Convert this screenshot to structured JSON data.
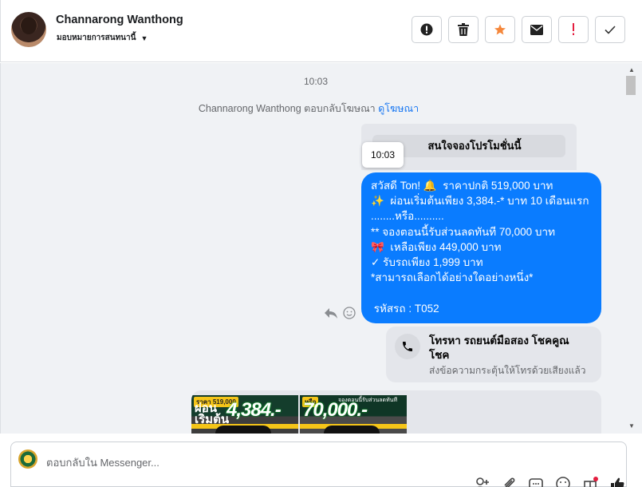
{
  "header": {
    "name": "Channarong Wanthong",
    "assign_label": "มอบหมายการสนทนานี้",
    "actions": [
      {
        "name": "report-button",
        "icon": "alert-circle-icon"
      },
      {
        "name": "delete-button",
        "icon": "trash-icon"
      },
      {
        "name": "star-button",
        "icon": "star-icon",
        "color": "#f5873b"
      },
      {
        "name": "mark-unread-button",
        "icon": "envelope-icon"
      },
      {
        "name": "spam-button",
        "icon": "exclamation-icon",
        "color": "#e41e3f"
      },
      {
        "name": "done-button",
        "icon": "check-icon"
      }
    ]
  },
  "conversation": {
    "timestamp": "10:03",
    "reply_note": "Channarong Wanthong ตอบกลับโฆษณา",
    "reply_link": "ดูโฆษณา",
    "quoted_message": "สนใจจองโปรโมชั่นนี้",
    "tooltip_time": "10:03",
    "message_lines": [
      "สวัสดี Ton! 🔔  ราคาปกติ 519,000 บาท",
      "✨  ผ่อนเริ่มต้นเพียง 3,384.-* บาท 10 เดือนแรก",
      "........หรือ..........",
      "** จองตอนนี้รับส่วนลดทันที 70,000 บาท",
      "🎀  เหลือเพียง 449,000 บาท",
      "✓ รับรถเพียง 1,999 บาท",
      "*สามารถเลือกได้อย่างใดอย่างหนึ่ง*",
      "",
      " รหัสรถ : T052"
    ],
    "message_color": "#0a7cff",
    "call_card": {
      "title": "โทรหา รถยนต์มือสอง โชคคูณโชค",
      "subtitle": "ส่งข้อความกระตุ้นให้โทรด้วยเสียงแล้ว"
    },
    "promo_images": [
      {
        "tag": "ราคา 519,000",
        "pre": "ผ่อน\nเริ่มต้น",
        "value": "4,384.-"
      },
      {
        "tag": "หรือ",
        "pre": "",
        "value": "70,000.-",
        "small": "จองตอนนี้รับส่วนลดทันที"
      }
    ]
  },
  "composer": {
    "placeholder": "ตอบกลับใน Messenger..."
  }
}
